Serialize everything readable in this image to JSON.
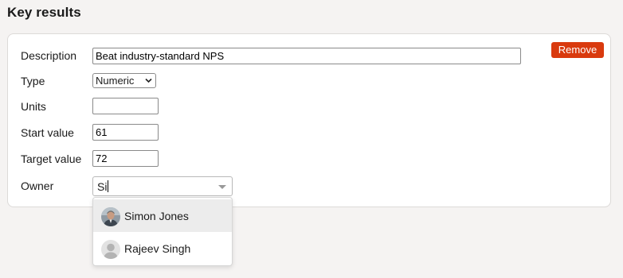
{
  "section": {
    "title": "Key results"
  },
  "key_result": {
    "remove_label": "Remove",
    "description_label": "Description",
    "description_value": "Beat industry-standard NPS",
    "type_label": "Type",
    "type_value": "Numeric",
    "units_label": "Units",
    "units_value": "",
    "start_label": "Start value",
    "start_value": "61",
    "target_label": "Target value",
    "target_value": "72",
    "owner_label": "Owner",
    "owner_query": "Si"
  },
  "owner_dropdown": {
    "options": [
      {
        "name": "Simon Jones",
        "avatar": "photo-avatar",
        "highlighted": true
      },
      {
        "name": "Rajeev Singh",
        "avatar": "default-avatar-icon",
        "highlighted": false
      }
    ]
  },
  "colors": {
    "remove_button": "#d93a0e",
    "page_background": "#f5f3f2",
    "highlight": "#ececec"
  }
}
